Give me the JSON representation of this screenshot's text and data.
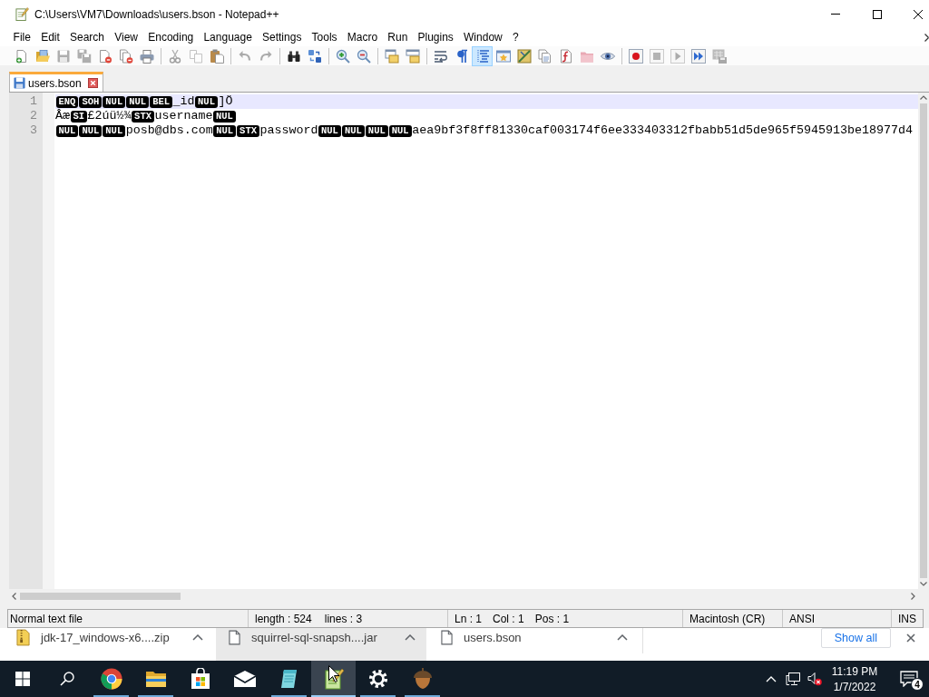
{
  "window": {
    "title": "C:\\Users\\VM7\\Downloads\\users.bson - Notepad++"
  },
  "menu": [
    "File",
    "Edit",
    "Search",
    "View",
    "Encoding",
    "Language",
    "Settings",
    "Tools",
    "Macro",
    "Run",
    "Plugins",
    "Window",
    "?"
  ],
  "toolbar": [
    [
      {
        "disabled": false,
        "pressed": false
      },
      {
        "disabled": false,
        "pressed": false
      },
      {
        "disabled": true,
        "pressed": false
      },
      {
        "disabled": true,
        "pressed": false
      },
      {
        "disabled": false,
        "pressed": false
      },
      {
        "disabled": false,
        "pressed": false
      },
      {
        "disabled": false,
        "pressed": false
      }
    ],
    [
      {
        "disabled": true,
        "pressed": false
      },
      {
        "disabled": true,
        "pressed": false
      },
      {
        "disabled": false,
        "pressed": false
      }
    ],
    [
      {
        "disabled": true,
        "pressed": false
      },
      {
        "disabled": true,
        "pressed": false
      }
    ],
    [
      {
        "disabled": false,
        "pressed": false
      },
      {
        "disabled": false,
        "pressed": false
      }
    ],
    [
      {
        "disabled": false,
        "pressed": false
      },
      {
        "disabled": false,
        "pressed": false
      }
    ],
    [
      {
        "disabled": false,
        "pressed": false
      },
      {
        "disabled": false,
        "pressed": false
      }
    ],
    [
      {
        "disabled": false,
        "pressed": false
      },
      {
        "disabled": false,
        "pressed": false
      },
      {
        "disabled": false,
        "pressed": true
      },
      {
        "disabled": false,
        "pressed": false
      },
      {
        "disabled": false,
        "pressed": false
      },
      {
        "disabled": false,
        "pressed": false
      },
      {
        "disabled": false,
        "pressed": false
      },
      {
        "disabled": false,
        "pressed": false
      },
      {
        "disabled": false,
        "pressed": false
      }
    ],
    [
      {
        "disabled": false,
        "pressed": false
      },
      {
        "disabled": true,
        "pressed": false
      },
      {
        "disabled": true,
        "pressed": false
      },
      {
        "disabled": false,
        "pressed": false
      },
      {
        "disabled": true,
        "pressed": false
      }
    ]
  ],
  "tabs": [
    {
      "label": "users.bson",
      "selected": true
    }
  ],
  "editor": {
    "lines": [
      {
        "number": "1",
        "current": true,
        "segments": [
          {
            "kind": "control",
            "text": "ENQ"
          },
          {
            "kind": "control",
            "text": "SOH"
          },
          {
            "kind": "control",
            "text": "NUL"
          },
          {
            "kind": "control",
            "text": "NUL"
          },
          {
            "kind": "control",
            "text": "BEL"
          },
          {
            "kind": "text",
            "text": "_id"
          },
          {
            "kind": "control",
            "text": "NUL"
          },
          {
            "kind": "text",
            "text": "]Ö"
          }
        ]
      },
      {
        "number": "2",
        "current": false,
        "segments": [
          {
            "kind": "text",
            "text": "Âæ"
          },
          {
            "kind": "control",
            "text": "SI"
          },
          {
            "kind": "text",
            "text": "£2úü½¾"
          },
          {
            "kind": "control",
            "text": "STX"
          },
          {
            "kind": "text",
            "text": "username"
          },
          {
            "kind": "control",
            "text": "NUL"
          }
        ]
      },
      {
        "number": "3",
        "current": false,
        "segments": [
          {
            "kind": "control",
            "text": "NUL"
          },
          {
            "kind": "control",
            "text": "NUL"
          },
          {
            "kind": "control",
            "text": "NUL"
          },
          {
            "kind": "text",
            "text": "posb@dbs.com"
          },
          {
            "kind": "control",
            "text": "NUL"
          },
          {
            "kind": "control",
            "text": "STX"
          },
          {
            "kind": "text",
            "text": "password"
          },
          {
            "kind": "control",
            "text": "NUL"
          },
          {
            "kind": "control",
            "text": "NUL"
          },
          {
            "kind": "control",
            "text": "NUL"
          },
          {
            "kind": "control",
            "text": "NUL"
          },
          {
            "kind": "text",
            "text": "aea9bf3f8ff81330caf003174f6ee333403312fbabb51d5de965f5945913be18977d4"
          }
        ]
      }
    ]
  },
  "status_bar": {
    "panes": [
      [
        "Normal text file"
      ],
      [
        "length : 524",
        "lines : 3"
      ],
      [
        "Ln : 1",
        "Col : 1",
        "Pos : 1"
      ],
      [
        "Macintosh (CR)"
      ],
      [
        "ANSI"
      ],
      [
        "INS"
      ]
    ]
  },
  "downloads_bar": {
    "items": [
      {
        "name": "jdk-17_windows-x6....zip",
        "kind": "zip",
        "highlighted": false
      },
      {
        "name": "squirrel-sql-snapsh....jar",
        "kind": "file",
        "highlighted": true
      },
      {
        "name": "users.bson",
        "kind": "file",
        "highlighted": false
      }
    ],
    "show_all": "Show all"
  },
  "taskbar": {
    "apps": [
      {
        "running": true,
        "active": false
      },
      {
        "running": true,
        "active": false
      },
      {
        "running": false,
        "active": false
      },
      {
        "running": false,
        "active": false
      },
      {
        "running": true,
        "active": false
      },
      {
        "running": true,
        "active": true
      },
      {
        "running": true,
        "active": false
      },
      {
        "running": true,
        "active": false
      }
    ],
    "clock": {
      "time": "11:19 PM",
      "date": "1/7/2022"
    },
    "notification_count": "4"
  }
}
